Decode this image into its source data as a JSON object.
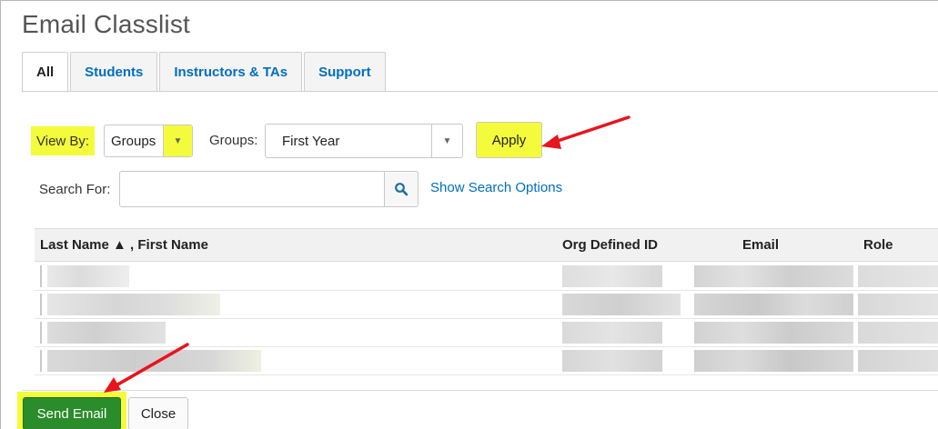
{
  "page": {
    "title": "Email Classlist"
  },
  "tabs": [
    {
      "label": "All",
      "active": true
    },
    {
      "label": "Students",
      "active": false
    },
    {
      "label": "Instructors & TAs",
      "active": false
    },
    {
      "label": "Support",
      "active": false
    }
  ],
  "filters": {
    "view_by_label": "View By:",
    "view_by_value": "Groups",
    "groups_label": "Groups:",
    "groups_value": "First Year",
    "apply_label": "Apply"
  },
  "search": {
    "label": "Search For:",
    "value": "",
    "placeholder": "",
    "show_options_label": "Show Search Options",
    "icon": "search-icon"
  },
  "table": {
    "columns": [
      "Last Name ▲ , First Name",
      "Org Defined ID",
      "Email",
      "Role"
    ],
    "row_count": 4
  },
  "actions": {
    "send_label": "Send Email",
    "close_label": "Close"
  },
  "colors": {
    "highlight": "#f4fb3a",
    "link": "#006fbf",
    "send_button": "#2a8c2a",
    "annotation_arrow": "#e8141e"
  }
}
